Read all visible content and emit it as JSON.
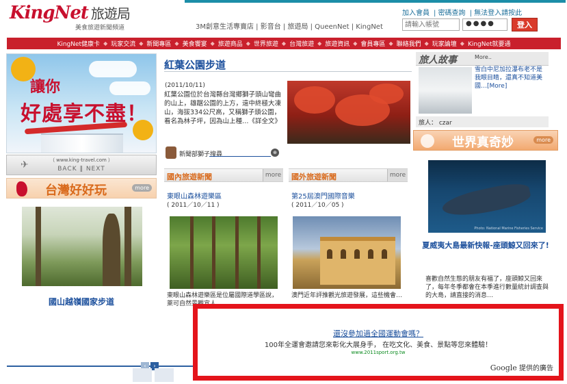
{
  "header": {
    "logo_text": "KingNet",
    "logo_cn": "旅遊局",
    "logo_sub": "美食旅遊新聞頻道",
    "top_links": "3M創意生活專賣店 | 影音台 | 旅遊局 | QueenNet | KingNet",
    "account_links": [
      "加入會員",
      "密碼查詢",
      "無法登入請按此"
    ],
    "login_placeholder": "請輸入帳號",
    "password_mask": "●●●●",
    "login_button": "登入"
  },
  "nav": {
    "items": [
      "KingNet健康卡",
      "玩家交流",
      "新聞專區",
      "美食饗宴",
      "旅遊商品",
      "世界旅遊",
      "台灣旅遊",
      "旅遊資訊",
      "會員專區",
      "聯絡我們",
      "玩家論壇",
      "KingNet就要通"
    ]
  },
  "left": {
    "hero_line1": "讓你",
    "hero_line2": "好處享不盡！",
    "slider_url": "（ www.king-travel.com ）",
    "slider_nav": "BACK ‖ NEXT",
    "taiwan_title": "台灣好好玩",
    "taiwan_more": "more",
    "taiwan_caption": "國山越嶺國家步道"
  },
  "article": {
    "title": "紅葉公園步道",
    "date": "(2011/10/11)",
    "body": "紅葉公園位於台灣縣台灣鄉獅子頭山彎曲的山上，雄踞公園的上方，遠中終極大凍山，海拔334公尺高，又稱獅子頭公園，看名為林子坪，因為山上種…《詳全文》",
    "author": "新聞部獅子搜尋",
    "author_more": "⊕"
  },
  "domestic": {
    "title": "國內旅遊新聞",
    "more": "more",
    "link": "東眼山森林遊樂區",
    "date": "( 2011／10／11 )",
    "desc": "東眼山森林遊樂區是位屬國際道學區說，萊可自然景觀宜人…"
  },
  "foreign": {
    "title": "國外旅遊新聞",
    "more": "more",
    "link": "第25屆澳門國際音樂",
    "date": "( 2011／10／05 )",
    "desc": "澳門近年評推觀光旅遊發展，這些機會…"
  },
  "story": {
    "title": "旅人故事",
    "more": "More..",
    "text": "雪白中尼加拉瀑布老不是我眼目睛，還真不知道美國…[More]",
    "author": "旅人： czar"
  },
  "world": {
    "title": "世界真奇妙",
    "more": "more",
    "credit": "Photo: National Marine Fisheries Service",
    "caption": "夏威夷大島最新快報-座頭鯨又回來了!",
    "desc": "喜歡自然生態的朋友有福了，座頭鯨又回來了，每年冬季都會在本季進行數量統計調查與的大島，請直接的消息…"
  },
  "ad": {
    "title": "還沒參加過全國運動會嗎？",
    "body": "100年全運會邀請您來彰化大展身手， 在吃文化、美食、景點等您來體驗！",
    "url": "www.2011sport.org.tw",
    "google": "Google",
    "google_suffix": "提供的廣告"
  },
  "pager": {
    "prev": "‹",
    "next": "›"
  }
}
